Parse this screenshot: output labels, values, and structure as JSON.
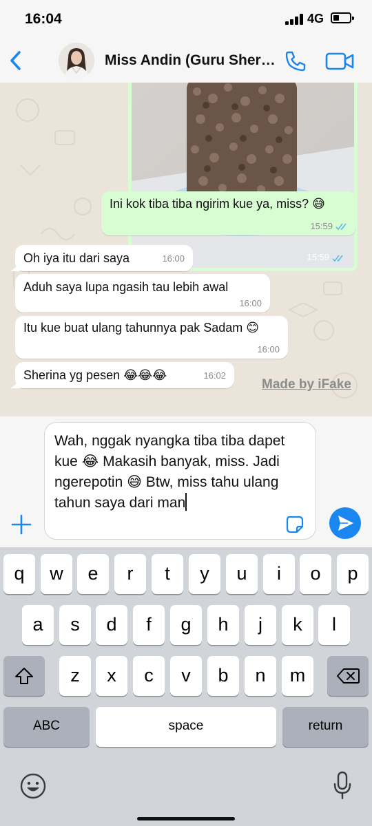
{
  "status_bar": {
    "time": "16:04",
    "network": "4G"
  },
  "header": {
    "contact_name": "Miss Andin (Guru Sherina)"
  },
  "image_message": {
    "time": "15:59",
    "status": "read"
  },
  "messages": [
    {
      "direction": "out",
      "text": "Ini kok tiba tiba ngirim kue ya, miss? 😅",
      "time": "15:59"
    },
    {
      "direction": "in",
      "text": "Oh iya itu dari saya",
      "time": "16:00"
    },
    {
      "direction": "in",
      "text": "Aduh saya lupa ngasih tau lebih awal",
      "time": "16:00"
    },
    {
      "direction": "in",
      "text": "Itu kue buat ulang tahunnya pak Sadam 😊",
      "time": "16:00"
    },
    {
      "direction": "in",
      "text": "Sherina yg pesen 😂😂😂",
      "time": "16:02"
    }
  ],
  "watermark": "Made by iFake",
  "composer": {
    "text": "Wah, nggak nyangka tiba tiba dapet kue 😂 Makasih banyak, miss. Jadi ngerepotin 😅 Btw, miss tahu ulang tahun saya dari man"
  },
  "keyboard": {
    "row1": [
      "q",
      "w",
      "e",
      "r",
      "t",
      "y",
      "u",
      "i",
      "o",
      "p"
    ],
    "row2": [
      "a",
      "s",
      "d",
      "f",
      "g",
      "h",
      "j",
      "k",
      "l"
    ],
    "row3": [
      "z",
      "x",
      "c",
      "v",
      "b",
      "n",
      "m"
    ],
    "abc_label": "ABC",
    "space_label": "space",
    "return_label": "return"
  },
  "colors": {
    "outgoing_bubble": "#d9fdd3",
    "incoming_bubble": "#ffffff",
    "accent_blue": "#1a86f0",
    "chat_wallpaper": "#eae4db",
    "read_tick": "#53bdeb"
  }
}
